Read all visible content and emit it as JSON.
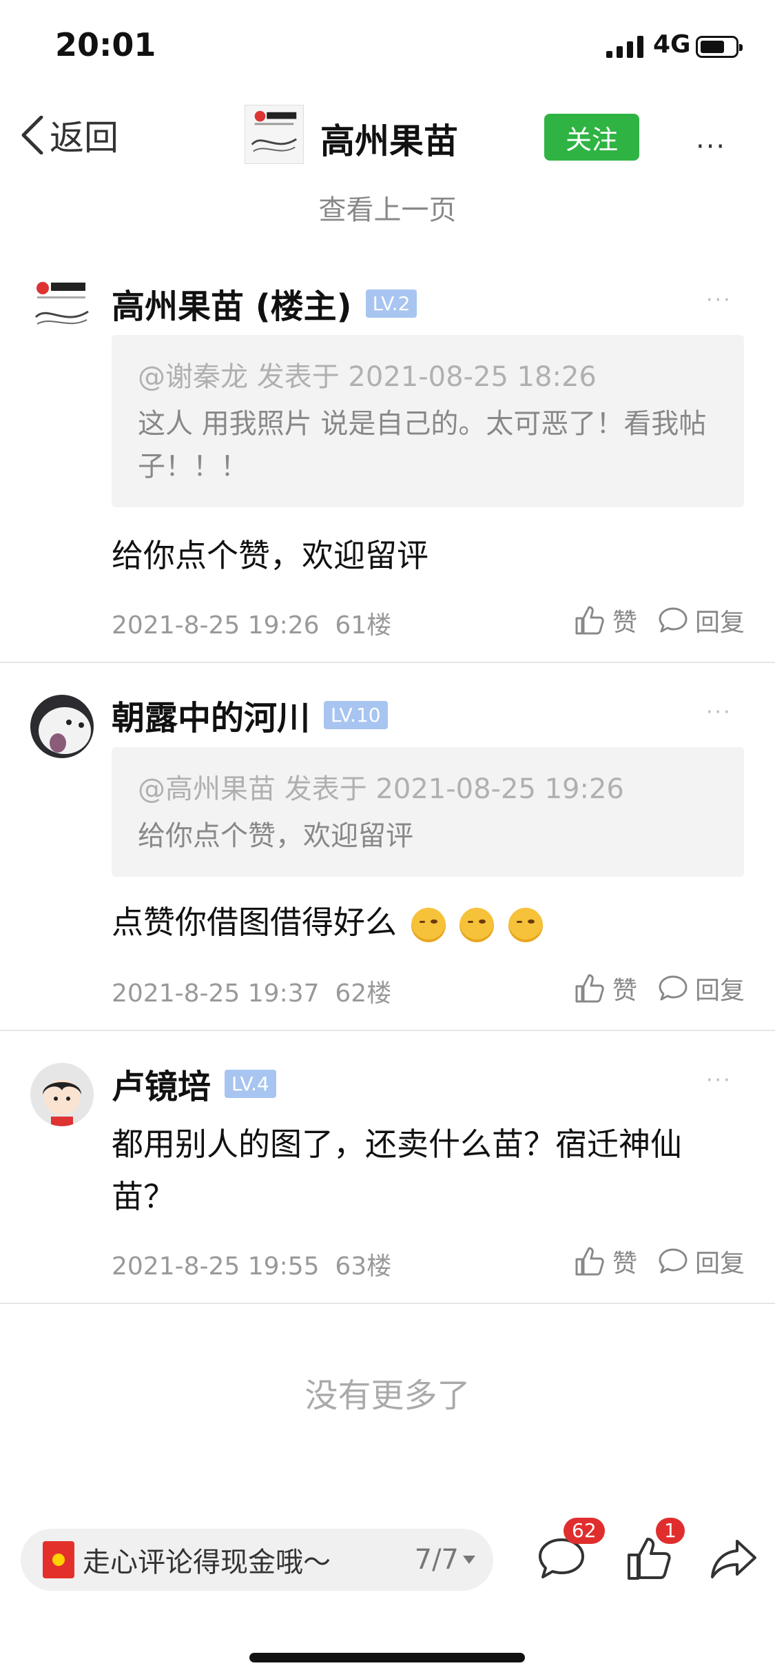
{
  "status_bar": {
    "time": "20:01",
    "network": "4G"
  },
  "nav": {
    "back_label": "返回",
    "title": "高州果苗",
    "follow_label": "关注",
    "more": "···"
  },
  "prev_page": "查看上一页",
  "posts": [
    {
      "name": "高州果苗 (楼主)",
      "level": "LV.2",
      "quote_meta": "@谢秦龙 发表于 2021-08-25 18:26",
      "quote_text": "这人 用我照片 说是自己的。太可恶了！看我帖子！！！",
      "body": "给你点个赞，欢迎留评",
      "time": "2021-8-25 19:26",
      "floor": "61楼",
      "like": "赞",
      "reply": "回复"
    },
    {
      "name": "朝露中的河川",
      "level": "LV.10",
      "quote_meta": "@高州果苗 发表于 2021-08-25 19:26",
      "quote_text": "给你点个赞，欢迎留评",
      "body": "点赞你借图借得好么",
      "time": "2021-8-25 19:37",
      "floor": "62楼",
      "like": "赞",
      "reply": "回复"
    },
    {
      "name": "卢镜培",
      "level": "LV.4",
      "body": "都用别人的图了，还卖什么苗？宿迁神仙苗？",
      "time": "2021-8-25 19:55",
      "floor": "63楼",
      "like": "赞",
      "reply": "回复"
    }
  ],
  "no_more": "没有更多了",
  "bottom_bar": {
    "comment_prompt": "走心评论得现金哦～",
    "page_indicator": "7/7",
    "comment_badge": "62",
    "like_badge": "1"
  },
  "colors": {
    "follow_green": "#2fb444",
    "level_blue": "#a7c5f0",
    "badge_red": "#e02e2e"
  }
}
